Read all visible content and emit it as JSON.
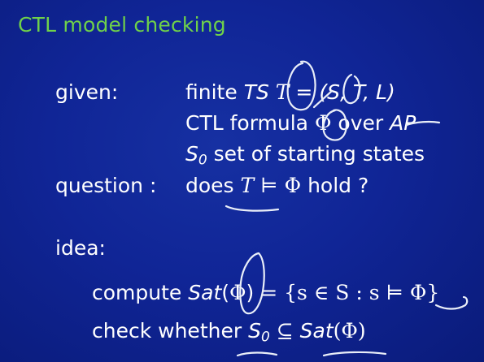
{
  "slide": {
    "title": "CTL model checking",
    "given_label": "given:",
    "question_label": "question :",
    "idea_label": "idea:",
    "line1": {
      "prefix": "finite",
      "ts": "TS",
      "t_sym": "T",
      "eq": "=",
      "tuple": "(S, T, L)"
    },
    "line2": {
      "prefix": "CTL formula",
      "phi": "Φ",
      "mid": "over",
      "ap": "AP"
    },
    "line3": {
      "s": "S",
      "sub": "0",
      "rest": "set of starting states"
    },
    "line4": {
      "does": "does",
      "t_sym": "T",
      "models": "⊨",
      "phi": "Φ",
      "rest": "hold ?"
    },
    "idea1": {
      "compute": "compute",
      "sat": "Sat",
      "open": "(",
      "phi": "Φ",
      "close": ")",
      "rest": "= {s ∈ S : s ⊨ Φ}"
    },
    "idea2": {
      "check": "check whether",
      "s": "S",
      "sub": "0",
      "subset": "⊆",
      "sat": "Sat",
      "arg": "(Φ)"
    }
  },
  "annotation_color": "#e9eef8"
}
